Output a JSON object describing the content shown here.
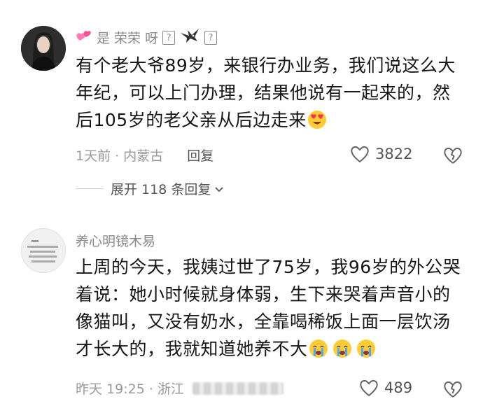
{
  "comments": [
    {
      "username": "是 荣荣 呀",
      "badge_icon": "pink-hearts-icon",
      "text": "有个老大爷89岁，来银行办业务，我们说这么大年纪，可以上门办理，结果他说有一起来的，然后105岁的老父亲从后边走来",
      "meta": "1天前 · 内蒙古",
      "reply_label": "回复",
      "likes": "3822"
    },
    {
      "username": "养心明镜木易",
      "text": "上周的今天，我姨过世了75岁，我96岁的外公哭着说：她小时候就身体弱，生下来哭着声音小的像猫叫，又没有奶水，全靠喝稀饭上面一层饮汤才长大的，我就知道她养不大",
      "meta": "昨天 19:25 · 浙江",
      "likes": "489"
    }
  ],
  "expand_replies": "展开 118 条回复",
  "colors": {
    "text": "#161616",
    "secondary": "#8a8a8a",
    "accent_pink": "#ff5fa0"
  }
}
